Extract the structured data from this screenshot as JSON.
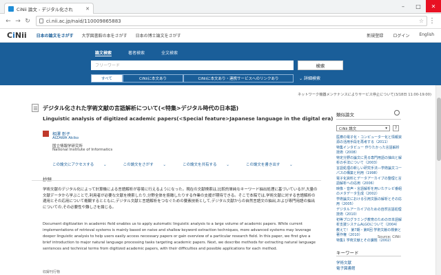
{
  "browser": {
    "tab_title": "CiNii 論文 - デジタル化され",
    "url": "ci.nii.ac.jp/naid/110009865883"
  },
  "site": {
    "logo_prefix": "C",
    "logo_i": "i",
    "logo_suffix": "Nii",
    "nav": [
      "日本の論文をさがす",
      "大学図書館の本をさがす",
      "日本の博士論文をさがす"
    ],
    "nav_right": [
      "新規登録",
      "ログイン",
      "English"
    ]
  },
  "search": {
    "tabs": [
      "論文検索",
      "著者検索",
      "全文検索"
    ],
    "placeholder": "フリーワード",
    "button": "検索",
    "filters": [
      "すべて",
      "CiNiiに本文あり",
      "CiNiiに本文あり・連携サービスへのリンクあり"
    ],
    "advanced": "詳細検索"
  },
  "notice": "ネットワーク機器メンテナンスによりサービス停止について(3/18日 11:00-19:00)",
  "article": {
    "title_ja": "デジタル化された学術文献の言語解析について(<特集>デジタル時代の日本語)",
    "title_en": "Linguistic analysis of digitized academic papers(<Special feature>Japanese language in the digital era)",
    "author_ja": "相澤 彰子",
    "author_en": "AIZAWA Akiko",
    "aff_ja": "国立情報学研究所",
    "aff_en": "National Institute of Informatics",
    "actions": [
      "この論文にアクセスする",
      "この論文をさがす",
      "この論文を共有する",
      "この論文を書き出す"
    ],
    "abstract_heading": "抄録",
    "abstract_ja": "学術文献のデジタル化によって計算機による言語解析が容易に行えるようになった。現在の文献検索は,比較的単純なキーワード抽出処理に基づいているが,大量の文献データから学ぶことで,利用者が必要な文献を検索したり,分野全体を俯瞰したりする作業の支援が期待できる。そこで本稿では,学術文献に対する言語解析の適用とその応用について概観するとともに,デジタル文献と言語解析をつなぐための要素技術として,デジタル文献からの自然言語文の抽出,および専門用語の抽出についての,その必要性や難しさを論じる。",
    "abstract_en": "Document digitization in academic field enables us to apply automatic linguistic analysis to a large volume of academic papers. While current implementations of retrieval systems is mainly based on naive and shallow keyword extraction techniques, more advanced systems may leverage deeper linguistic analysis to help users easily access necessary papers or gain overview of a particular research field. In this paper, we first give a brief introduction to major natural language processing tasks targeting academic papers. Next, we describe methods for extracting natural language sentences and technical terms from digitized academic papers, with their difficulties and possible applications for each method.",
    "trail": "収録刊行物"
  },
  "sidebar": {
    "related_heading": "類似論文",
    "select_value": "CiNii 論文",
    "question": "?",
    "related": [
      "医療の電子化・コンピューター化と情報資源の活用手段を再考する（2011）",
      "特集インタビュー 作りたかった言語解析技術（2008）",
      "特定分野の論文に見る専門用語の抽出と解析の手法について（2003）",
      "言語処理の新しい研究手法―学術論文コーパスの構築と利用（1998）",
      "電子化資料とデータアーカイブの整理と言語解析への応用（2006）",
      "映像・音声・言語解析を用いたテレビ番組のメタデータ生成（2002）",
      "学術論文における引用文脈の解析とその応用（2005）",
      "デジタルアーカイブのための自然言語処理技術（2010）",
      "初等プログラミング教育のための日本語解析支援システムALGOについて（2004）",
      "教えて！ 第7期・第8回 学術文献の検索と著作権（2010）",
      "特集1 学術文献とその課題（2002）"
    ],
    "source": "Source: CiNii",
    "keywords_heading": "キーワード",
    "keywords": [
      "学術文献",
      "電子図書館"
    ]
  }
}
